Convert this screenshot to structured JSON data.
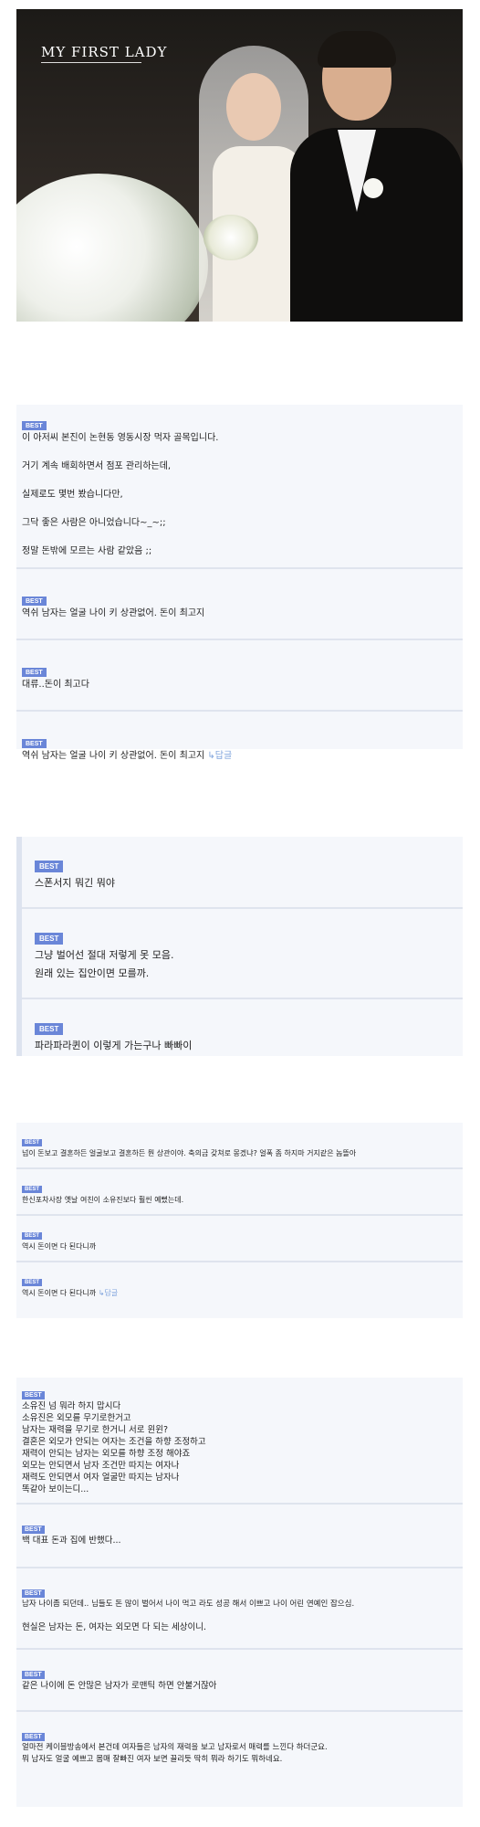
{
  "hero": {
    "logo_text": "MY FIRST LADY"
  },
  "panel1": {
    "comments": [
      {
        "badge": "BEST",
        "lines": [
          "이 아저씨 본진이 논현동 영동시장 먹자 골목입니다.",
          "거기 계속 배회하면서 점포 관리하는데,",
          "실제로도 몇번 봤습니다만,",
          "그닥 좋은 사람은 아니었습니다~_~;;",
          "정말 돈밖에 모르는 사람 같았음 ;;"
        ]
      },
      {
        "badge": "BEST",
        "lines": [
          "역쉬 남자는 얼굴 나이 키 상관없어. 돈이 최고지"
        ]
      },
      {
        "badge": "BEST",
        "lines": [
          "대류..돈이 최고다"
        ]
      },
      {
        "badge": "BEST",
        "lines": [
          "역쉬 남자는 얼굴 나이 키 상관없어. 돈이 최고지"
        ],
        "reply": "↳답글"
      }
    ]
  },
  "panel2": {
    "comments": [
      {
        "badge": "BEST",
        "lines": [
          "스폰서지 뭐긴 뭐야"
        ]
      },
      {
        "badge": "BEST",
        "lines": [
          "그냥 벌어선 절대 저렇게 못 모음.",
          "원래 있는 집안이면 모를까."
        ]
      },
      {
        "badge": "BEST",
        "lines": [
          "파라파라퀸이 이렇게 가는구나 빠빠이"
        ]
      }
    ]
  },
  "panel3": {
    "comments": [
      {
        "badge": "BEST",
        "lines": [
          "넘이 돈보고 결혼하든 얼굴보고 결혼하든 뭔 상관이야. 축의금 갖쳐로 몽겠냐? 얼폭 좀 하지마 거지같은 놈뜰아"
        ]
      },
      {
        "badge": "BEST",
        "lines": [
          "한신포차사장 옛날 여친이 소유진보다 훨씬 예뻤는데."
        ]
      },
      {
        "badge": "BEST",
        "lines": [
          "역시 돈이면 다 된다니까"
        ]
      },
      {
        "badge": "BEST",
        "lines": [
          "역시 돈이면 다 된다니까"
        ],
        "reply": "↳답글"
      }
    ]
  },
  "panel4": {
    "comments": [
      {
        "badge": "BEST",
        "lines": [
          "소유진 넘 뭐라 하지 맙시다",
          "소유진은 외모를 무기로한거고",
          "남자는 재력을 무기로 한거니 서로 윈윈?",
          "결혼은 외모가 안되는 여자는 조건을 하향 조정하고",
          "재력이 안되는 남자는 외모를 하향 조정 해야죠",
          "외모는 안되면서 남자 조건만 따지는 여자나",
          "재력도 안되면서 여자 얼굴만 따지는 남자나",
          "똑같아 보이는디..."
        ]
      },
      {
        "badge": "BEST",
        "lines": [
          "백 대표 돈과 집에 반했다..."
        ]
      },
      {
        "badge": "BEST",
        "lines": [
          "남자 나이좀 되던데.. 님들도 돈 많이 벌어서 나이 먹고 라도 성공 해서 이쁘고 나이 어린 연예인 잡으심."
        ],
        "lines2": [
          "현실은 남자는 돈, 여자는 외모면 다 되는 세상이니."
        ]
      },
      {
        "badge": "BEST",
        "lines": [
          "같은 나이에 돈 안많은 남자가 로맨틱 하면 안불거잖아"
        ]
      },
      {
        "badge": "BEST",
        "lines": [
          "얼마전 케이블방송에서 본건데 여자들은 남자의 재력을 보고 남자로서 매력를 느낀다 하더군요.",
          "뭐 남자도 얼굴 예쁘고 몸매 잘빠진 여자 보면 끌리듯 딱히 뭐라 하기도 뭐하네요."
        ]
      }
    ]
  }
}
